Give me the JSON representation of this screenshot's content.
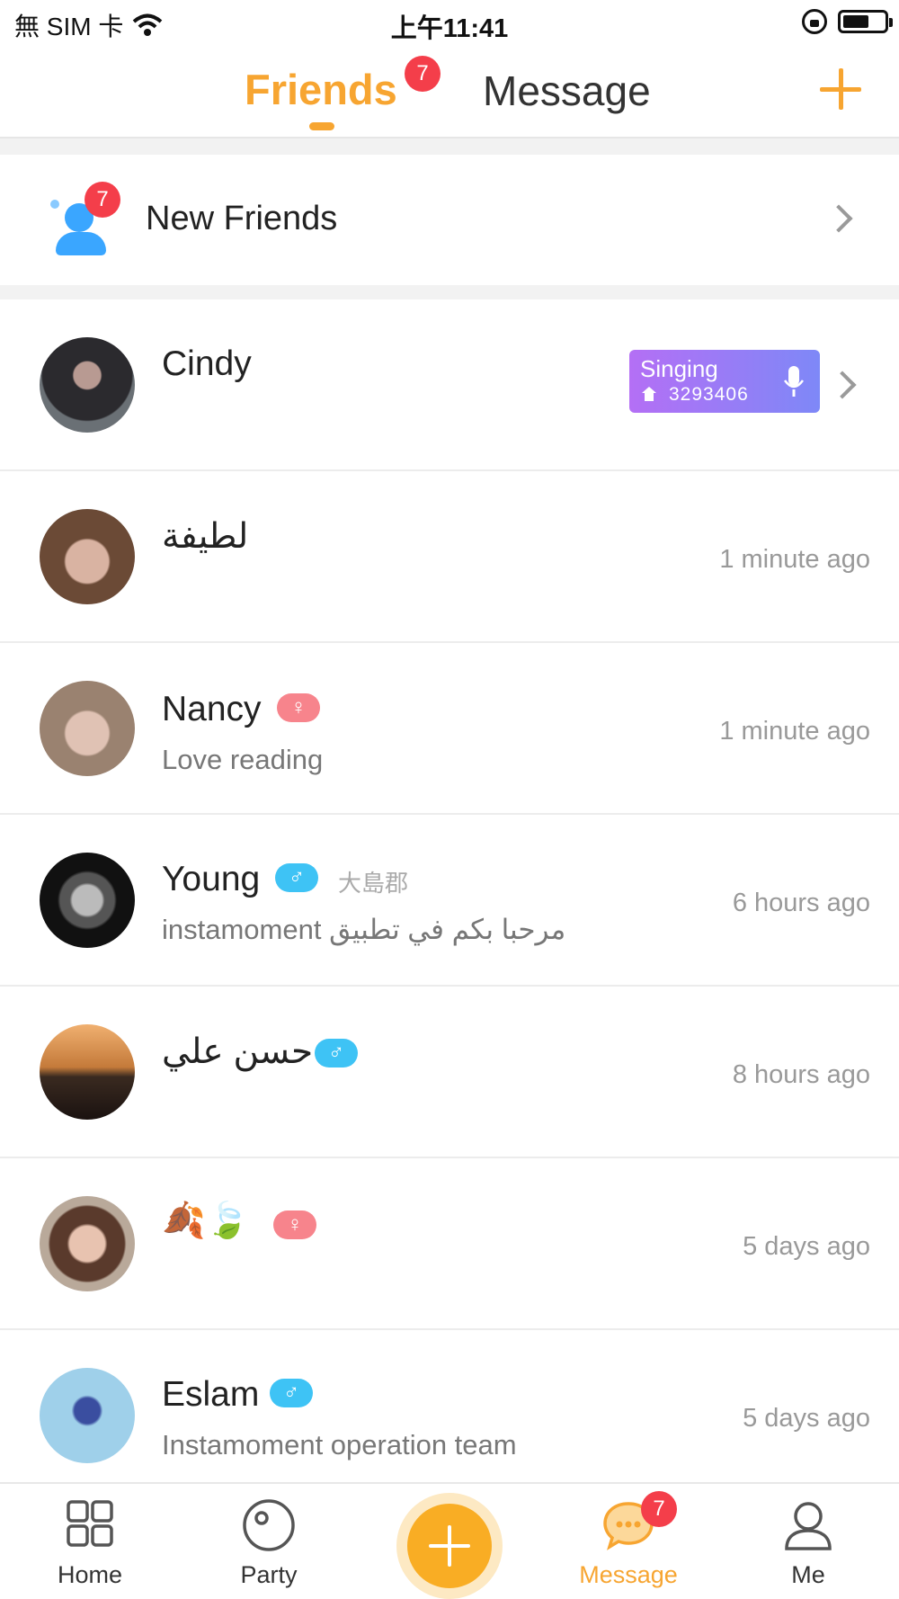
{
  "status_bar": {
    "carrier": "無 SIM 卡",
    "time": "上午11:41"
  },
  "header": {
    "tabs": [
      {
        "label": "Friends",
        "badge": "7",
        "active": true
      },
      {
        "label": "Message",
        "active": false
      }
    ],
    "add_icon": "plus-icon"
  },
  "new_friends": {
    "label": "New Friends",
    "badge": "7"
  },
  "friends": [
    {
      "name": "Cindy",
      "singing": {
        "label": "Singing",
        "room_id": "3293406"
      }
    },
    {
      "name": "لطيفة",
      "time": "1 minute ago"
    },
    {
      "name": "Nancy",
      "gender": "female",
      "gender_symbol": "♀",
      "status": "Love reading",
      "time": "1 minute ago"
    },
    {
      "name": "Young",
      "gender": "male",
      "gender_symbol": "♂",
      "location": "大島郡",
      "status": "instamoment مرحبا بكم في تطبيق",
      "time": "6 hours ago"
    },
    {
      "name": "حسن علي",
      "gender": "male",
      "gender_symbol": "♂",
      "time": "8 hours ago"
    },
    {
      "name": "🍂🍃",
      "gender": "female",
      "gender_symbol": "♀",
      "time": "5 days ago"
    },
    {
      "name": "Eslam",
      "gender": "male",
      "gender_symbol": "♂",
      "status": "Instamoment operation team",
      "time": "5 days ago"
    }
  ],
  "bottom_nav": [
    {
      "label": "Home",
      "icon": "grid-icon"
    },
    {
      "label": "Party",
      "icon": "party-icon"
    },
    {
      "label": "",
      "icon": "plus-icon"
    },
    {
      "label": "Message",
      "icon": "chat-bubble-icon",
      "badge": "7",
      "active": true
    },
    {
      "label": "Me",
      "icon": "person-icon"
    }
  ],
  "colors": {
    "accent": "#f7a531",
    "badge": "#f43e4a",
    "male": "#3ec3f5",
    "female": "#f7848c",
    "singing_start": "#b46ff5",
    "singing_end": "#7e88f7"
  }
}
